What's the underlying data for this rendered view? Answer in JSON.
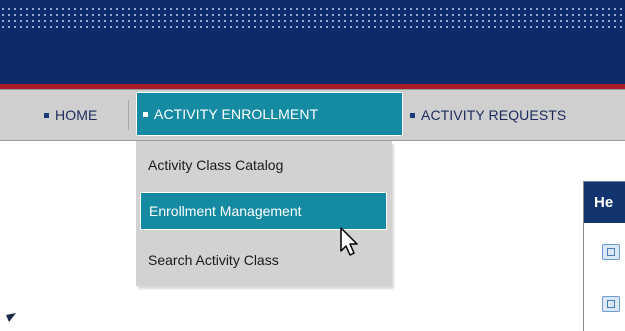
{
  "nav": {
    "items": [
      {
        "label": "HOME"
      },
      {
        "label": "ACTIVITY ENROLLMENT",
        "active": true
      },
      {
        "label": "ACTIVITY REQUESTS"
      }
    ]
  },
  "dropdown": {
    "items": [
      {
        "label": "Activity Class Catalog"
      },
      {
        "label": "Enrollment Management",
        "highlighted": true
      },
      {
        "label": "Search Activity Class"
      }
    ]
  },
  "side_panel": {
    "header_text": "He",
    "icons": [
      "page-icon",
      "page-icon"
    ]
  },
  "colors": {
    "banner": "#0d2a6b",
    "banner_stripe": "#a61b25",
    "nav_bg": "#cfcfcf",
    "accent": "#148aa3"
  }
}
